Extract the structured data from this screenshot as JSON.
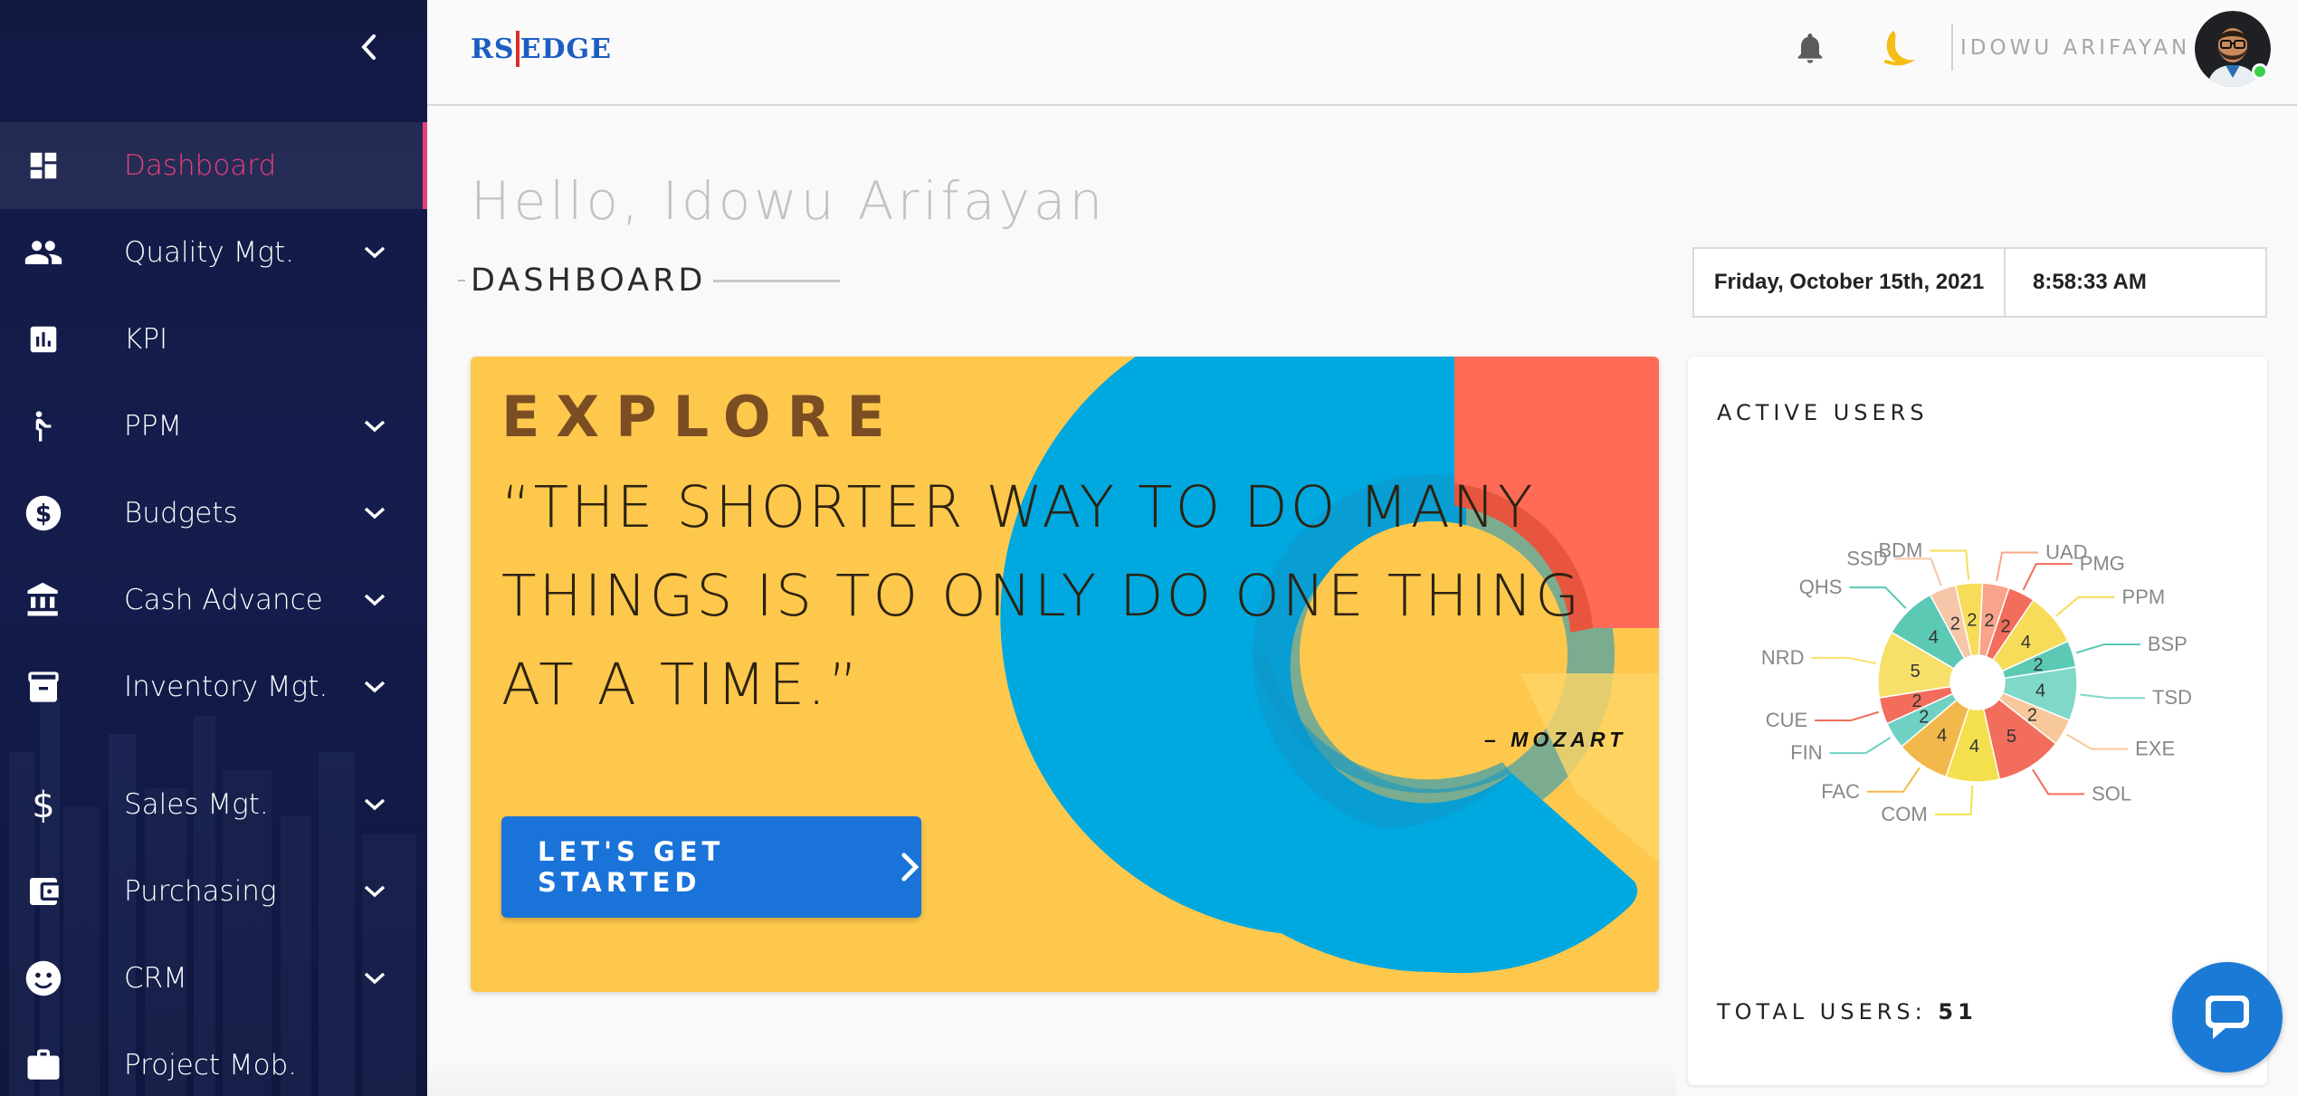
{
  "sidebar": {
    "collapse_icon": "chevron-left-icon",
    "items": [
      {
        "label": "Dashboard",
        "icon": "dashboard-icon",
        "active": true,
        "expandable": false
      },
      {
        "label": "Quality Mgt.",
        "icon": "people-icon",
        "active": false,
        "expandable": true
      },
      {
        "label": "KPI",
        "icon": "bar-chart-icon",
        "active": false,
        "expandable": false
      },
      {
        "label": "PPM",
        "icon": "person-walking-icon",
        "active": false,
        "expandable": true
      },
      {
        "label": "Budgets",
        "icon": "dollar-circle-icon",
        "active": false,
        "expandable": true
      },
      {
        "label": "Cash Advance",
        "icon": "bank-icon",
        "active": false,
        "expandable": true
      },
      {
        "label": "Inventory Mgt.",
        "icon": "archive-icon",
        "active": false,
        "expandable": true
      },
      {
        "label": "Sales Mgt.",
        "icon": "dollar-icon",
        "active": false,
        "expandable": true
      },
      {
        "label": "Purchasing",
        "icon": "wallet-icon",
        "active": false,
        "expandable": true
      },
      {
        "label": "CRM",
        "icon": "face-icon",
        "active": false,
        "expandable": true
      },
      {
        "label": "Project Mob.",
        "icon": "briefcase-icon",
        "active": false,
        "expandable": false
      }
    ],
    "active_color": "#e8407a"
  },
  "header": {
    "logo_left": "RS",
    "logo_right": "EDGE",
    "username": "IDOWU ARIFAYAN",
    "notification_icon": "bell-icon",
    "theme_icon": "moon-icon"
  },
  "main": {
    "greeting": "Hello, Idowu Arifayan",
    "page_title": "DASHBOARD",
    "date": "Friday, October 15th, 2021",
    "time": "8:58:33 AM"
  },
  "explore": {
    "title": "EXPLORE",
    "quote": "“THE SHORTER WAY TO DO MANY THINGS IS TO ONLY DO ONE THING AT A TIME.”",
    "author": "– MOZART",
    "cta_label": "LET'S GET STARTED",
    "colors": {
      "background": "#fec84d",
      "donut_blue": "#00a8e0",
      "donut_red": "#ff6b57",
      "button": "#1a73d9"
    }
  },
  "active_users": {
    "title": "ACTIVE USERS",
    "total_label": "TOTAL USERS:",
    "total_value": "51"
  },
  "chart_data": {
    "type": "pie",
    "title": "ACTIVE USERS",
    "categories": [
      "UAD",
      "PMG",
      "PPM",
      "BSP",
      "TSD",
      "EXE",
      "SOL",
      "COM",
      "FAC",
      "FIN",
      "CUE",
      "NRD",
      "QHS",
      "SSD",
      "BDM"
    ],
    "values": [
      2,
      2,
      4,
      2,
      4,
      2,
      5,
      4,
      4,
      2,
      2,
      5,
      4,
      2,
      2
    ],
    "colors": [
      "#f9a48a",
      "#f26d5b",
      "#f7dc5a",
      "#5cc9b5",
      "#7fd8c8",
      "#f7c89b",
      "#f26d5b",
      "#f4e04d",
      "#f2b84b",
      "#6fd1c3",
      "#f26d5b",
      "#f7e06a",
      "#5cc9b5",
      "#f6c6a8",
      "#f7dc5a"
    ]
  },
  "chat": {
    "icon": "chat-icon"
  }
}
